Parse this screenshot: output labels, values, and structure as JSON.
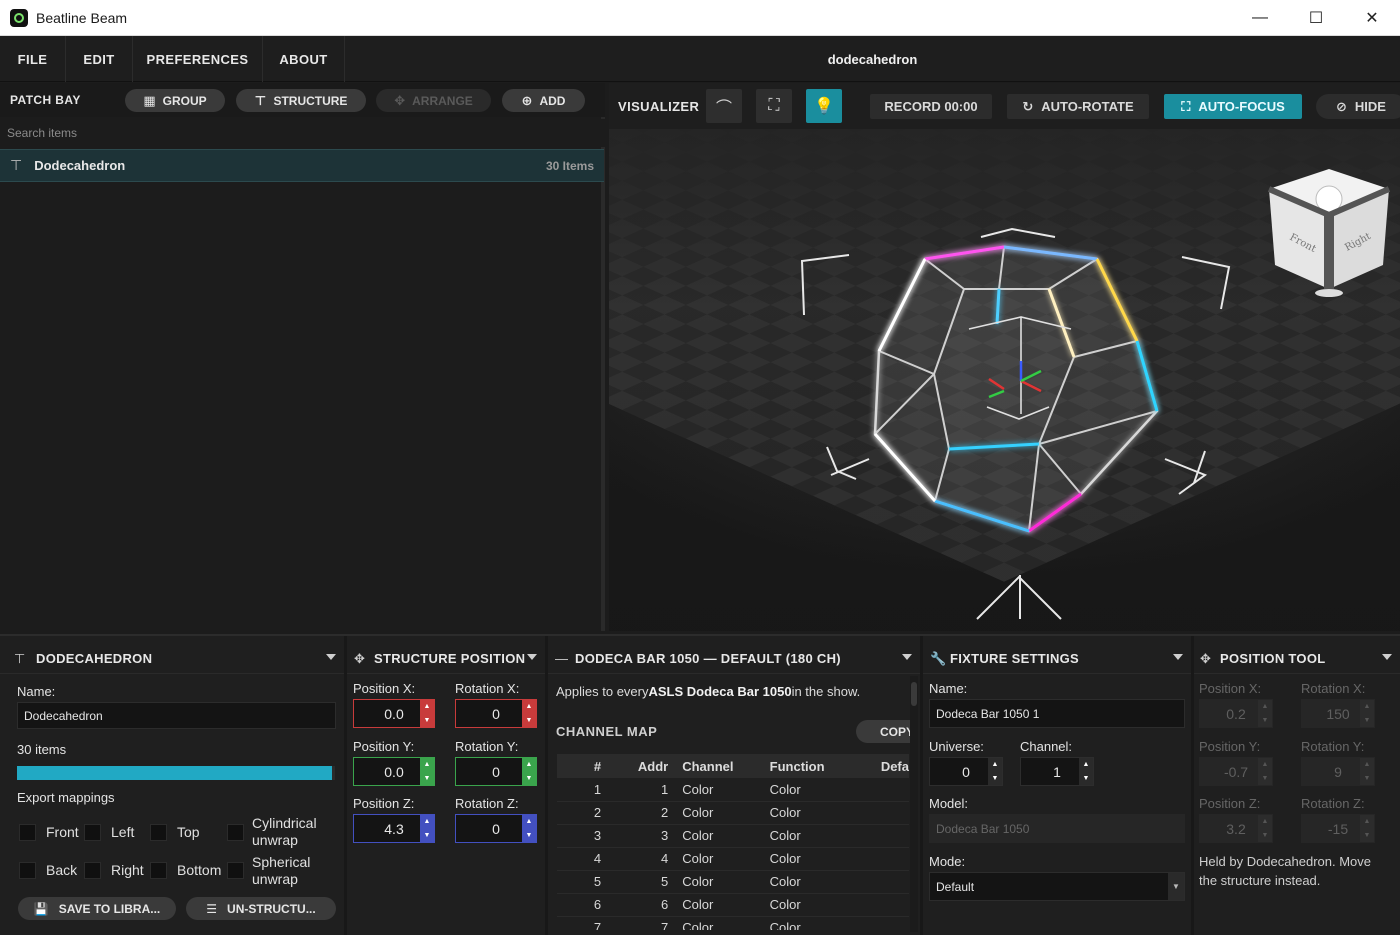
{
  "window": {
    "title": "Beatline Beam",
    "minimize_icon": "—",
    "maximize_icon": "☐",
    "close_icon": "✕"
  },
  "menu": {
    "items": [
      "FILE",
      "EDIT",
      "PREFERENCES",
      "ABOUT"
    ],
    "document_title": "dodecahedron"
  },
  "patch_bay": {
    "title": "PATCH BAY",
    "buttons": {
      "group": "GROUP",
      "structure": "STRUCTURE",
      "arrange": "ARRANGE",
      "add": "ADD"
    },
    "search_placeholder": "Search items",
    "items": [
      {
        "name": "Dodecahedron",
        "count": "30 Items",
        "icon": "structure-icon"
      }
    ]
  },
  "visualizer": {
    "title": "VISUALIZER",
    "record_label": "RECORD 00:00",
    "auto_rotate_label": "AUTO-ROTATE",
    "auto_focus_label": "AUTO-FOCUS",
    "hide_label": "HIDE",
    "view_cube": {
      "front": "Front",
      "right": "Right"
    },
    "accent": "#1a8e9e"
  },
  "dodecahedron_panel": {
    "title": "DODECAHEDRON",
    "name_label": "Name:",
    "name_value": "Dodecahedron",
    "items_count": "30 items",
    "progress": 0.99,
    "export_label": "Export mappings",
    "mappings": {
      "front": "Front",
      "left": "Left",
      "top": "Top",
      "cylindrical_1": "Cylindrical",
      "cylindrical_2": "unwrap",
      "back": "Back",
      "right": "Right",
      "bottom": "Bottom",
      "spherical_1": "Spherical",
      "spherical_2": "unwrap"
    },
    "save_label": "SAVE TO LIBRA...",
    "unstructure_label": "UN-STRUCTU..."
  },
  "structure_position": {
    "title": "STRUCTURE POSITION",
    "pos_x_label": "Position X:",
    "pos_x": "0.0",
    "rot_x_label": "Rotation X:",
    "rot_x": "0",
    "pos_y_label": "Position Y:",
    "pos_y": "0.0",
    "rot_y_label": "Rotation Y:",
    "rot_y": "0",
    "pos_z_label": "Position Z:",
    "pos_z": "4.3",
    "rot_z_label": "Rotation Z:",
    "rot_z": "0"
  },
  "fixture_profile": {
    "title": "DODECA BAR 1050 — DEFAULT (180 CH)",
    "desc_pre": "Applies to every",
    "desc_bold": "ASLS Dodeca Bar 1050",
    "desc_post": "in the show.",
    "channel_map_label": "CHANNEL MAP",
    "copy_label": "COPY",
    "columns": [
      "#",
      "Addr",
      "Channel",
      "Function",
      "Defa"
    ],
    "rows": [
      [
        "1",
        "1",
        "Color",
        "Color"
      ],
      [
        "2",
        "2",
        "Color",
        "Color"
      ],
      [
        "3",
        "3",
        "Color",
        "Color"
      ],
      [
        "4",
        "4",
        "Color",
        "Color"
      ],
      [
        "5",
        "5",
        "Color",
        "Color"
      ],
      [
        "6",
        "6",
        "Color",
        "Color"
      ],
      [
        "7",
        "7",
        "Color",
        "Color"
      ]
    ]
  },
  "fixture_settings": {
    "title": "FIXTURE SETTINGS",
    "name_label": "Name:",
    "name_value": "Dodeca Bar 1050 1",
    "universe_label": "Universe:",
    "universe": "0",
    "channel_label": "Channel:",
    "channel": "1",
    "model_label": "Model:",
    "model_value": "Dodeca Bar 1050",
    "mode_label": "Mode:",
    "mode_value": "Default"
  },
  "position_tool": {
    "title": "POSITION TOOL",
    "pos_x_label": "Position X:",
    "pos_x": "0.2",
    "rot_x_label": "Rotation X:",
    "rot_x": "150",
    "pos_y_label": "Position Y:",
    "pos_y": "-0.7",
    "rot_y_label": "Rotation Y:",
    "rot_y": "9",
    "pos_z_label": "Position Z:",
    "pos_z": "3.2",
    "rot_z_label": "Rotation Z:",
    "rot_z": "-15",
    "note": "Held by Dodecahedron. Move the structure instead."
  }
}
